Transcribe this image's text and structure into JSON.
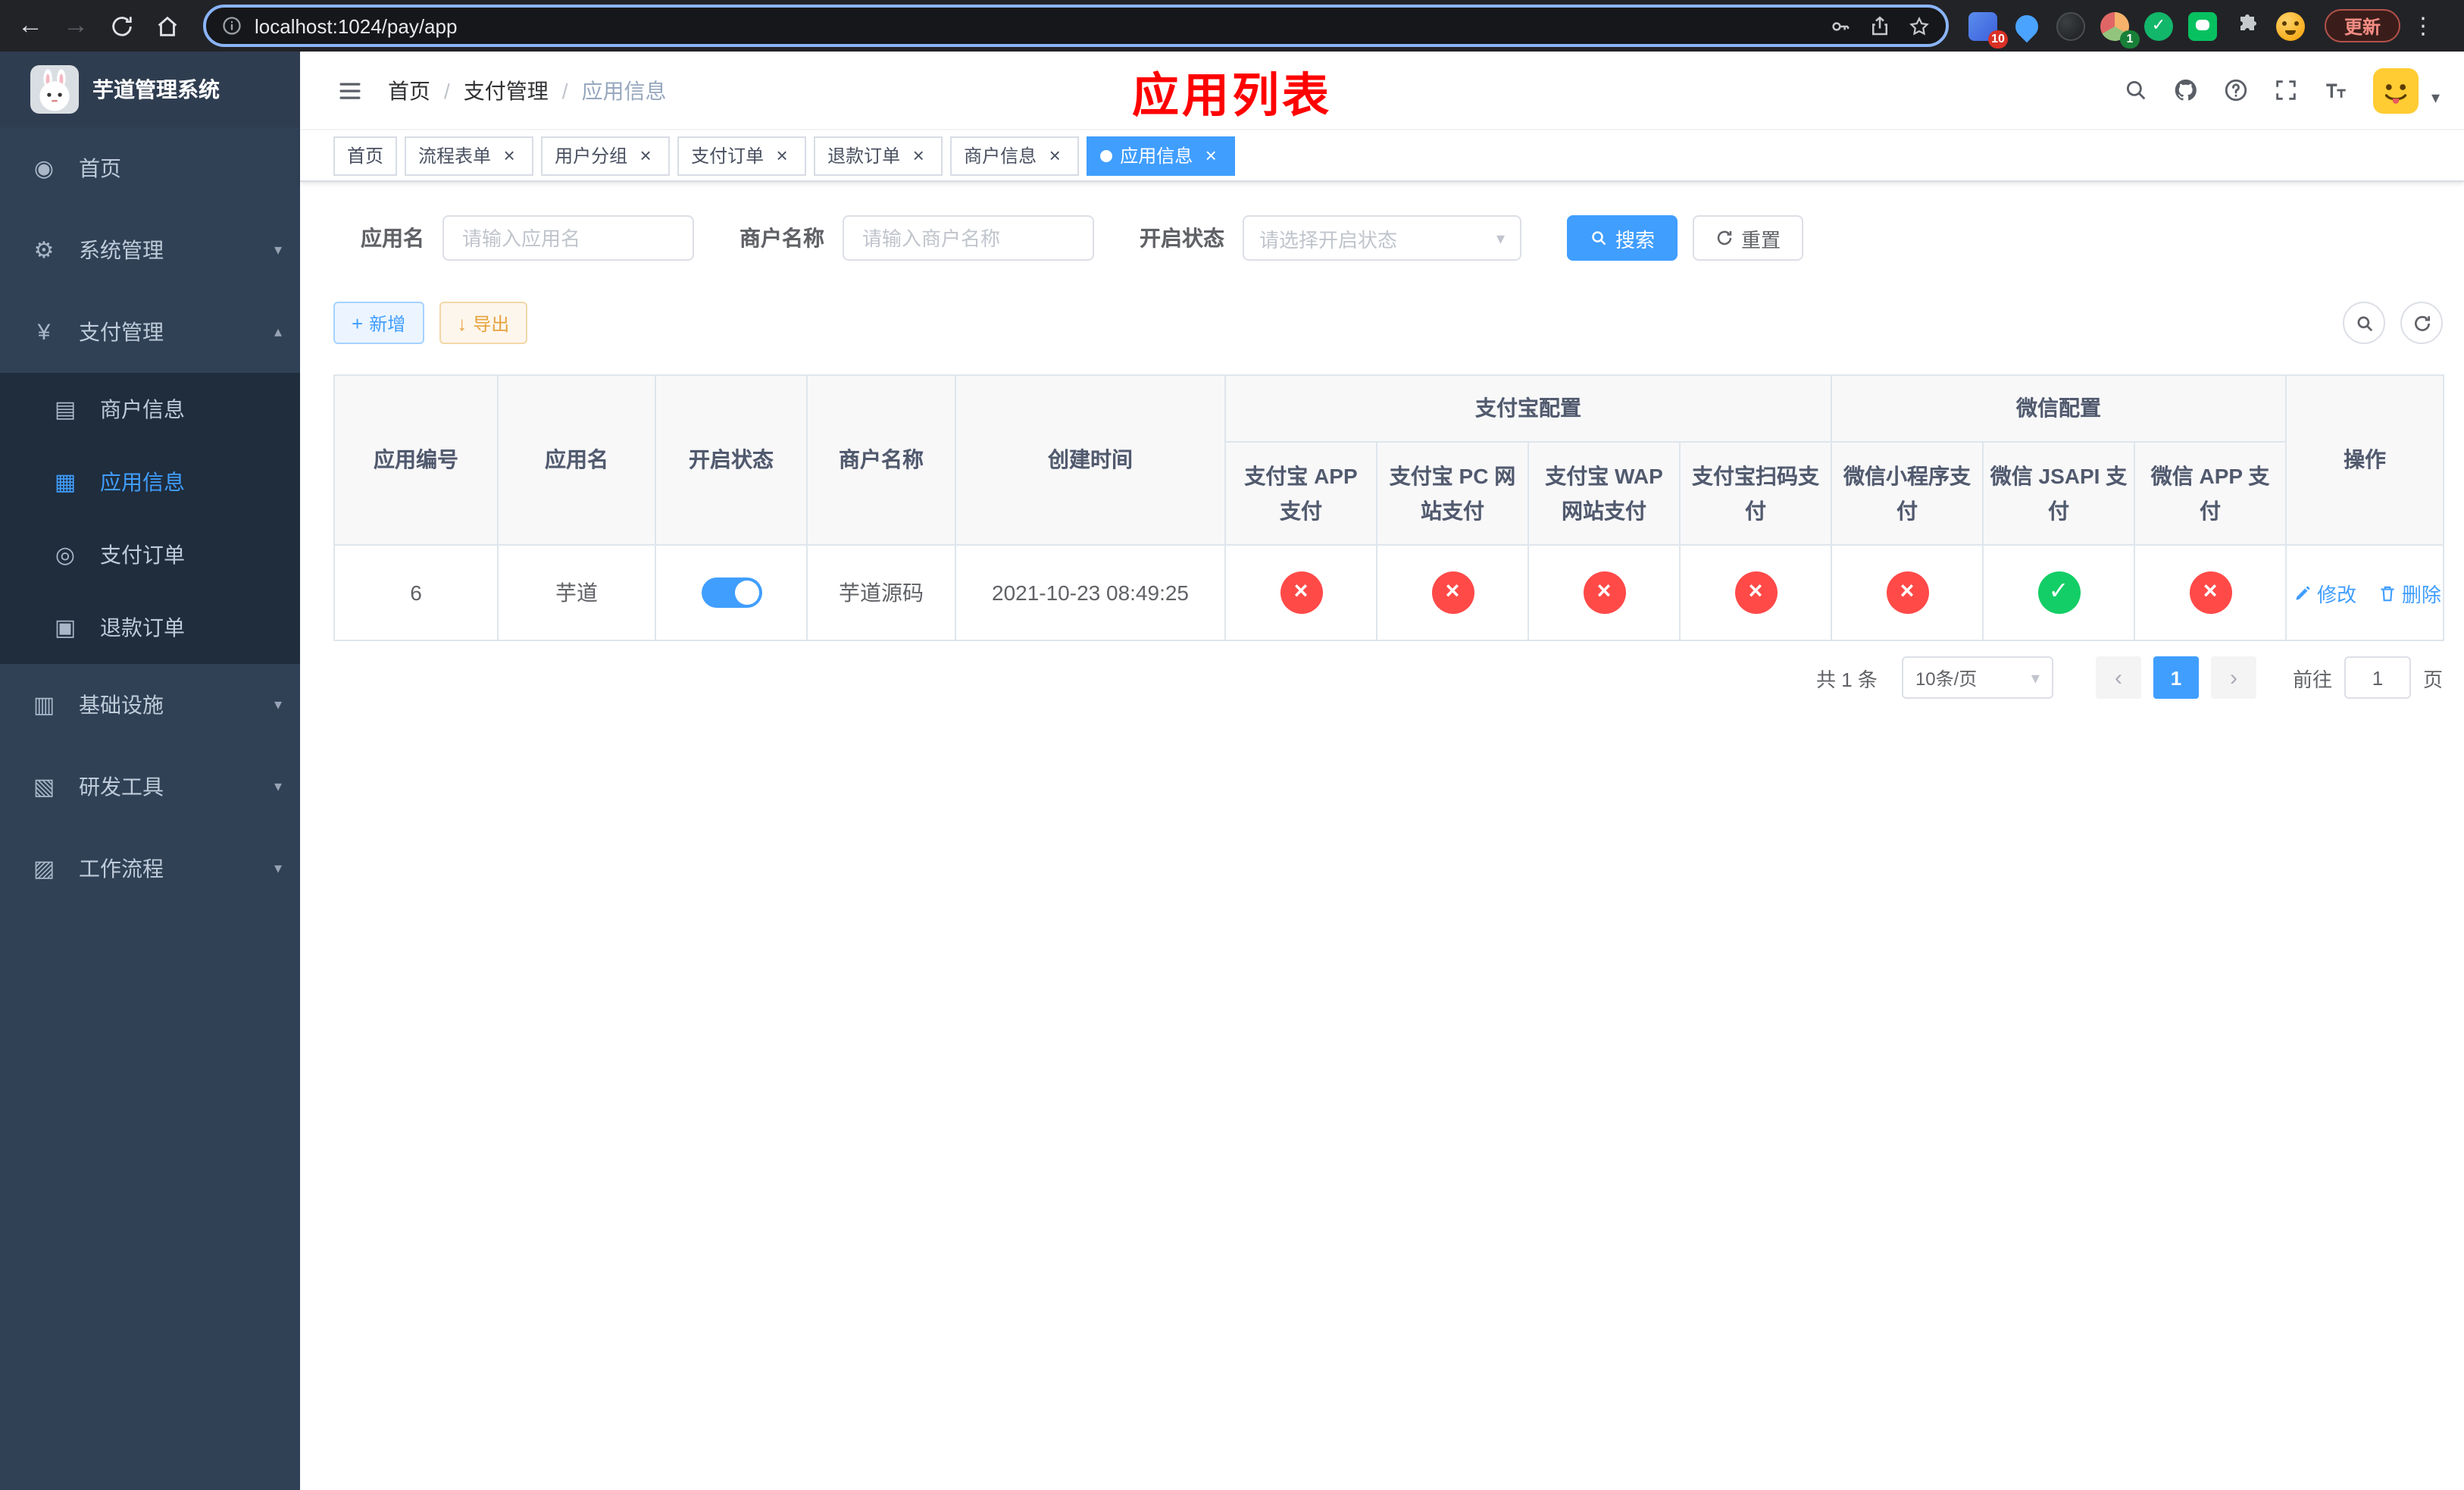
{
  "browser": {
    "url": "localhost:1024/pay/app",
    "update_button": "更新",
    "ext_badge_1": "10",
    "ext_badge_4": "1"
  },
  "icons": {
    "back": "←",
    "forward": "→",
    "menu_dots": "⋮",
    "close": "×",
    "caret_down": "▾",
    "caret_up": "▴",
    "check": "✓",
    "cross": "×",
    "plus": "+",
    "download": "↓",
    "prev": "‹",
    "next": "›",
    "dashboard": "◉",
    "gear": "⚙",
    "yen": "¥",
    "merchant": "▤",
    "app": "▦",
    "order": "◎",
    "refund": "▣",
    "infra": "▥",
    "tools": "▧",
    "workflow": "▨"
  },
  "sidebar": {
    "title": "芋道管理系统",
    "items": [
      {
        "label": "首页"
      },
      {
        "label": "系统管理"
      },
      {
        "label": "支付管理",
        "children": [
          {
            "label": "商户信息"
          },
          {
            "label": "应用信息"
          },
          {
            "label": "支付订单"
          },
          {
            "label": "退款订单"
          }
        ]
      },
      {
        "label": "基础设施"
      },
      {
        "label": "研发工具"
      },
      {
        "label": "工作流程"
      }
    ]
  },
  "header": {
    "breadcrumb": [
      "首页",
      "支付管理",
      "应用信息"
    ],
    "separator": "/",
    "page_title": "应用列表"
  },
  "tabs": [
    {
      "label": "首页"
    },
    {
      "label": "流程表单"
    },
    {
      "label": "用户分组"
    },
    {
      "label": "支付订单"
    },
    {
      "label": "退款订单"
    },
    {
      "label": "商户信息"
    },
    {
      "label": "应用信息"
    }
  ],
  "filters": {
    "app_name_label": "应用名",
    "app_name_placeholder": "请输入应用名",
    "merchant_label": "商户名称",
    "merchant_placeholder": "请输入商户名称",
    "status_label": "开启状态",
    "status_placeholder": "请选择开启状态",
    "search_button": "搜索",
    "reset_button": "重置"
  },
  "toolbar": {
    "add_button": "新增",
    "export_button": "导出"
  },
  "table": {
    "headers": {
      "app_id": "应用编号",
      "app_name": "应用名",
      "status": "开启状态",
      "merchant": "商户名称",
      "create_time": "创建时间",
      "alipay_group": "支付宝配置",
      "wechat_group": "微信配置",
      "actions": "操作",
      "alipay_app": "支付宝 APP 支付",
      "alipay_pc": "支付宝 PC 网站支付",
      "alipay_wap": "支付宝 WAP 网站支付",
      "alipay_qr": "支付宝扫码支付",
      "wechat_mini": "微信小程序支付",
      "wechat_jsapi": "微信 JSAPI 支付",
      "wechat_app": "微信 APP 支付"
    },
    "rows": [
      {
        "app_id": "6",
        "app_name": "芋道",
        "status_enabled": true,
        "merchant": "芋道源码",
        "create_time": "2021-10-23 08:49:25",
        "alipay_app": false,
        "alipay_pc": false,
        "alipay_wap": false,
        "alipay_qr": false,
        "wechat_mini": false,
        "wechat_jsapi": true,
        "wechat_app": false,
        "edit_label": "修改",
        "delete_label": "删除"
      }
    ]
  },
  "pagination": {
    "total": "共 1 条",
    "page_size": "10条/页",
    "page": "1",
    "goto": "前往",
    "goto_value": "1",
    "unit": "页"
  },
  "colors": {
    "primary": "#409EFF",
    "success": "#13ce66",
    "danger": "#ff4a48",
    "warning": "#E6A23C",
    "sidebar_bg": "#304156",
    "submenu_bg": "#1f2d3d",
    "title_red": "#FF0000"
  }
}
